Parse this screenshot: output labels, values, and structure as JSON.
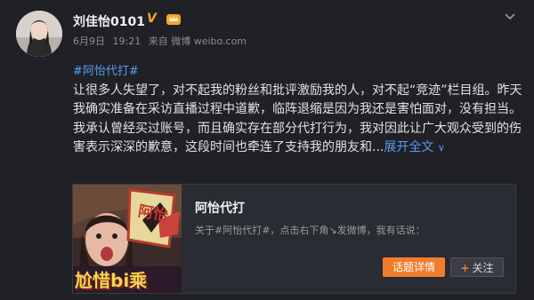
{
  "user": {
    "name": "刘佳怡0101",
    "verified_mark": "V",
    "badge_icon": "crown-icon"
  },
  "meta": {
    "date": "6月9日",
    "time": "19:21",
    "source": "来自 微博 weibo.com"
  },
  "post": {
    "hashtag": "#阿怡代打#",
    "paragraph1": "让很多人失望了，对不起我的粉丝和批评激励我的人，对不起“竞迹”栏目组。昨天我确实准备在采访直播过程中道歉，临阵退缩是因为我还是害怕面对，没有担当。",
    "paragraph2": "我承认曾经买过账号，而且确实存在部分代打行为，我对因此让广大观众受到的伤害表示深深的歉意，这段时间也牵连了支持我的朋友和...",
    "expand_label": "展开全文",
    "expand_icon": "chevron-down-icon"
  },
  "card": {
    "title": "阿怡代打",
    "description": "关于#阿怡代打#，点击右下角↘发微博，我有话说：",
    "thumb_text_top": "阿怡",
    "thumb_text_bottom": "尬惜bi乘",
    "topic_button": "话题详情",
    "follow_button": "关注",
    "follow_plus": "+"
  },
  "colors": {
    "background": "#1f2127",
    "link": "#5a9bea",
    "accent": "#f07d2b",
    "verified": "#f5a623"
  }
}
